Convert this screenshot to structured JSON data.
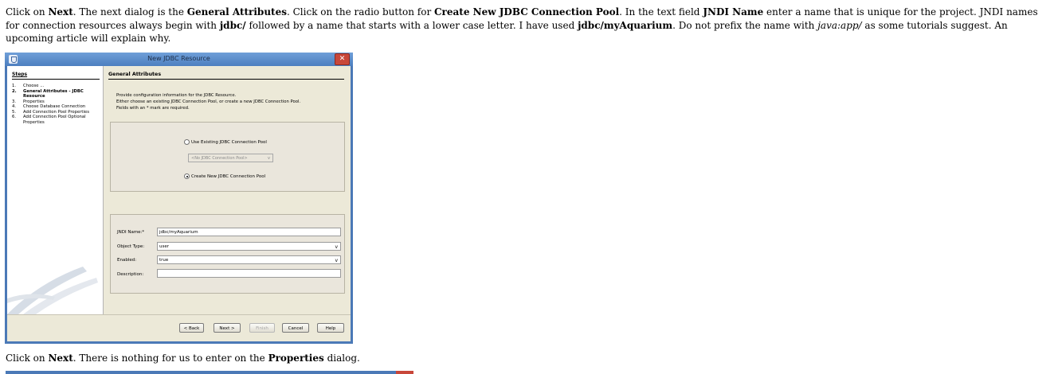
{
  "article": {
    "p1": [
      {
        "t": "Click on ",
        "s": ""
      },
      {
        "t": "Next",
        "s": "b"
      },
      {
        "t": ". The next dialog is the ",
        "s": ""
      },
      {
        "t": "General Attributes",
        "s": "b"
      },
      {
        "t": ". Click on the radio button for ",
        "s": ""
      },
      {
        "t": "Create New JDBC Connection Pool",
        "s": "b"
      },
      {
        "t": ". In the text field ",
        "s": ""
      },
      {
        "t": "JNDI Name",
        "s": "b"
      },
      {
        "t": " enter a name that is unique for the project. JNDI names for connection resources always begin with ",
        "s": ""
      },
      {
        "t": "jdbc/",
        "s": "b"
      },
      {
        "t": " followed by a name that starts with a lower case letter. I have used ",
        "s": ""
      },
      {
        "t": "jdbc/myAquarium",
        "s": "b"
      },
      {
        "t": ". Do not prefix the name with ",
        "s": ""
      },
      {
        "t": "java:app/",
        "s": "i"
      },
      {
        "t": " as some tutorials suggest. An upcoming article will explain why.",
        "s": ""
      }
    ],
    "p2": [
      {
        "t": "Click on ",
        "s": ""
      },
      {
        "t": "Next",
        "s": "b"
      },
      {
        "t": ". There is nothing for us to enter on the ",
        "s": ""
      },
      {
        "t": "Properties",
        "s": "b"
      },
      {
        "t": " dialog.",
        "s": ""
      }
    ]
  },
  "dialog": {
    "title": "New JDBC Resource",
    "close_glyph": "✕",
    "steps_heading": "Steps",
    "steps": [
      {
        "num": "1.",
        "label": "Choose ...",
        "active": false
      },
      {
        "num": "2.",
        "label": "General Attributes - JDBC Resource",
        "active": true
      },
      {
        "num": "3.",
        "label": "Properties",
        "active": false
      },
      {
        "num": "4.",
        "label": "Choose Database Connection",
        "active": false
      },
      {
        "num": "5.",
        "label": "Add Connection Pool Properties",
        "active": false
      },
      {
        "num": "6.",
        "label": "Add Connection Pool Optional Properties",
        "active": false
      }
    ],
    "section_heading": "General Attributes",
    "description": [
      "Provide configuration information for the JDBC Resource.",
      "Either choose an existing JDBC Connection Pool, or create a new JDBC Connection Pool.",
      "Fields with an * mark are required."
    ],
    "radio_existing": {
      "label": "Use Existing JDBC Connection Pool",
      "checked": false
    },
    "pool_select": {
      "value": "<No JDBC Connection Pool>",
      "chevron": "v"
    },
    "radio_create": {
      "label": "Create New JDBC Connection Pool",
      "checked": true
    },
    "fields": {
      "jndi_label": "JNDI Name:*",
      "jndi_value": "jdbc/myAquarium",
      "object_type_label": "Object Type:",
      "object_type_value": "user",
      "enabled_label": "Enabled:",
      "enabled_value": "true",
      "description_label": "Description:",
      "description_value": "",
      "chevron": "v"
    },
    "buttons": {
      "back": "< Back",
      "next": "Next >",
      "finish": "Finish",
      "cancel": "Cancel",
      "help": "Help"
    }
  }
}
